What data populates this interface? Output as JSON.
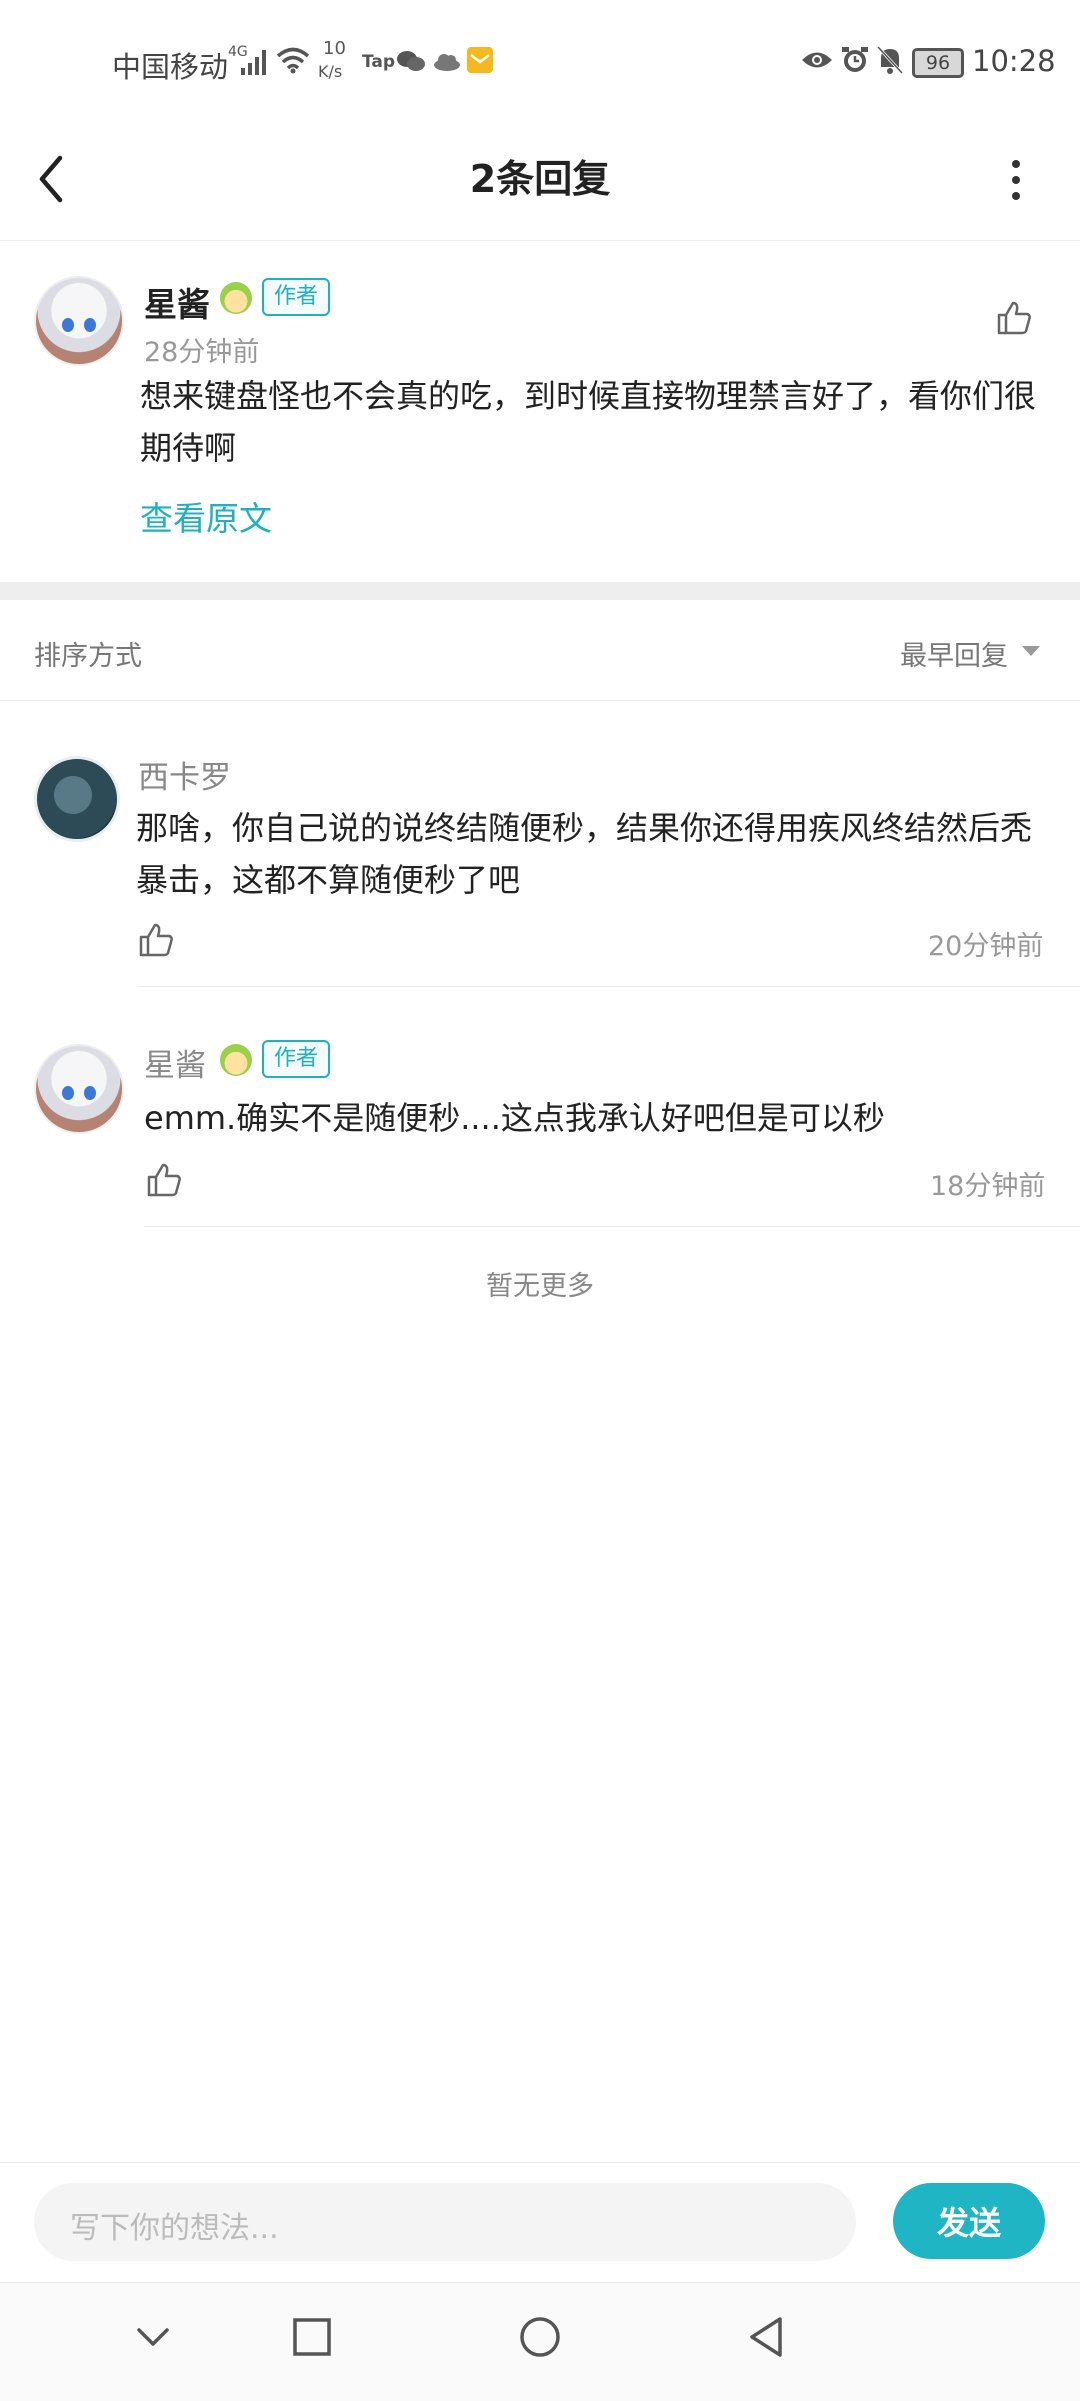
{
  "status_bar": {
    "carrier": "中国移动",
    "network": "4G",
    "speed_value": "10",
    "speed_unit": "K/s",
    "tap_label": "Tap",
    "battery": "96",
    "time": "10:28"
  },
  "header": {
    "title": "2条回复"
  },
  "original_comment": {
    "author": "星酱",
    "badge": "作者",
    "time": "28分钟前",
    "text": "想来键盘怪也不会真的吃，到时候直接物理禁言好了，看你们很期待啊",
    "view_original": "查看原文"
  },
  "sort": {
    "label": "排序方式",
    "selected": "最早回复"
  },
  "replies": [
    {
      "author": "西卡罗",
      "text": "那啥，你自己说的说终结随便秒，结果你还得用疾风终结然后秃暴击，这都不算随便秒了吧",
      "time": "20分钟前"
    },
    {
      "author": "星酱",
      "badge": "作者",
      "text": "emm.确实不是随便秒....这点我承认好吧但是可以秒",
      "time": "18分钟前"
    }
  ],
  "footer_note": "暂无更多",
  "input": {
    "placeholder": "写下你的想法...",
    "send": "发送"
  },
  "colors": {
    "accent": "#1fb5c4",
    "link": "#1fb0c2"
  }
}
